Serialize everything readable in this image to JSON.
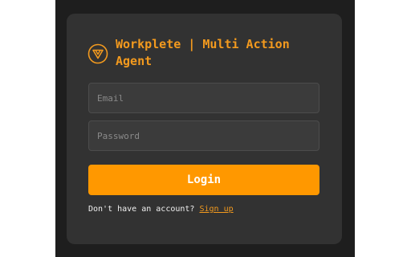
{
  "brand": {
    "title": "Workplete | Multi Action Agent",
    "accent_color": "#f39a1e",
    "logo_icon": "workplete-logo-icon"
  },
  "form": {
    "email_placeholder": "Email",
    "email_value": "",
    "password_placeholder": "Password",
    "password_value": "",
    "login_label": "Login",
    "login_color": "#ff9800"
  },
  "signup": {
    "prompt": "Don't have an account?",
    "link_label": "Sign up"
  },
  "colors": {
    "backdrop": "#1e1e1e",
    "card": "#323232",
    "input": "#3b3b3b"
  }
}
